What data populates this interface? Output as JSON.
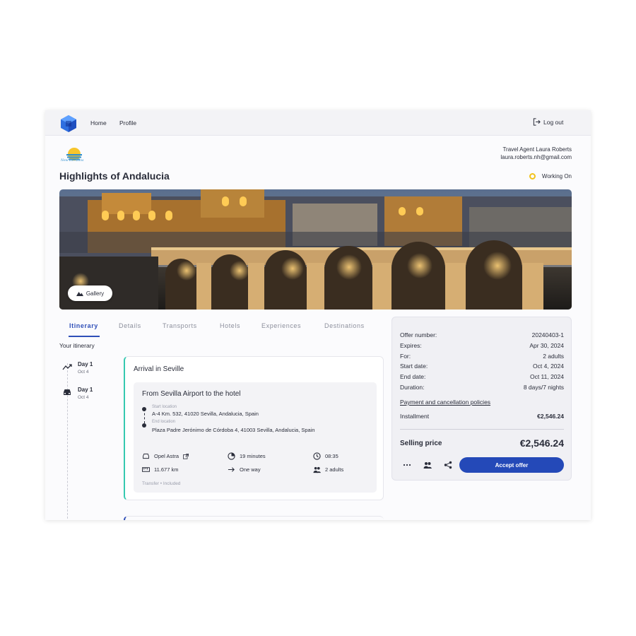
{
  "nav": {
    "home": "Home",
    "profile": "Profile",
    "logout": "Log out"
  },
  "agency": {
    "name": "New Horizons"
  },
  "agent": {
    "label": "Travel Agent",
    "name": "Laura Roberts",
    "email": "laura.roberts.nh@gmail.com"
  },
  "page": {
    "title": "Highlights of Andalucia",
    "status": "Working On"
  },
  "hero": {
    "gallery_label": "Gallery"
  },
  "tabs": [
    "Itinerary",
    "Details",
    "Transports",
    "Hotels",
    "Experiences",
    "Destinations"
  ],
  "itinerary": {
    "heading": "Your itinerary",
    "days": [
      {
        "label": "Day 1",
        "date": "Oct 4",
        "icon": "trend-icon"
      },
      {
        "label": "Day 1",
        "date": "Oct 4",
        "icon": "car-icon"
      }
    ],
    "card_title": "Arrival in Seville",
    "transfer": {
      "title": "From Sevilla Airport to the hotel",
      "start_label": "Start location",
      "start_value": "A-4 Km. 532, 41020 Sevilla, Andalucia, Spain",
      "end_label": "End location",
      "end_value": "Plaza Padre Jerónimo de Córdoba 4, 41003 Sevilla, Andalucia, Spain",
      "vehicle": "Opel Astra",
      "duration": "19 minutes",
      "time": "08:35",
      "distance": "11.677 km",
      "direction": "One way",
      "passengers": "2 adults",
      "footnote": "Transfer • Included"
    }
  },
  "offer": {
    "rows": [
      {
        "label": "Offer number:",
        "value": "20240403-1"
      },
      {
        "label": "Expires:",
        "value": "Apr 30, 2024"
      },
      {
        "label": "For:",
        "value": "2 adults"
      },
      {
        "label": "Start date:",
        "value": "Oct 4, 2024"
      },
      {
        "label": "End date:",
        "value": "Oct 11, 2024"
      },
      {
        "label": "Duration:",
        "value": "8 days/7 nights"
      }
    ],
    "policy_link": "Payment and cancellation policies",
    "installment_label": "Installment",
    "installment_value": "€2,546.24",
    "selling_label": "Selling price",
    "selling_value": "€2,546.24",
    "accept_label": "Accept offer"
  },
  "colors": {
    "accent": "#2449b8",
    "status": "#f2c21a",
    "card_border": "#35c9b0"
  }
}
